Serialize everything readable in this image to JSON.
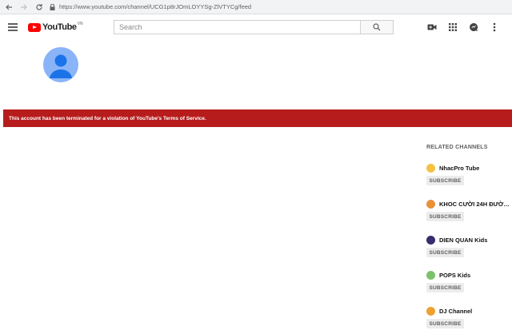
{
  "browser": {
    "url": "https://www.youtube.com/channel/UCG1p8rJOmLOYYSg-ZlVTYCg/feed"
  },
  "header": {
    "logo_text": "YouTube",
    "logo_country": "VN",
    "search_placeholder": "Search"
  },
  "banner": {
    "message": "This account has been terminated for a violation of YouTube's Terms of Service."
  },
  "related": {
    "title": "RELATED CHANNELS",
    "channels": [
      {
        "name": "NhacPro Tube",
        "subscribe": "SUBSCRIBE"
      },
      {
        "name": "KHOC CƯỜI 24H ĐƯỜNG",
        "subscribe": "SUBSCRIBE"
      },
      {
        "name": "DIEN QUAN Kids",
        "subscribe": "SUBSCRIBE"
      },
      {
        "name": "POPS Kids",
        "subscribe": "SUBSCRIBE"
      },
      {
        "name": "DJ Channel",
        "subscribe": "SUBSCRIBE"
      }
    ]
  },
  "colors": {
    "banner": "#b71c1c",
    "brand_red": "#ff0000",
    "avatar": "#8ab4f8"
  },
  "icons": [
    "back-icon",
    "forward-icon",
    "reload-icon",
    "lock-icon",
    "menu-icon",
    "search-icon",
    "video-camera-icon",
    "apps-grid-icon",
    "messages-icon",
    "more-vert-icon",
    "avatar-icon"
  ]
}
